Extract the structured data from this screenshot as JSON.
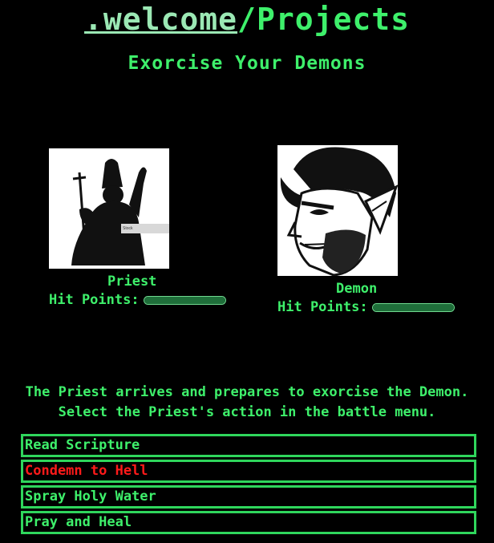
{
  "header": {
    "home_link": ".welcome",
    "separator": "/",
    "page": "Projects"
  },
  "game": {
    "title": "Exorcise Your Demons",
    "priest": {
      "name": "Priest",
      "hp_label": "Hit Points:",
      "hp_fraction": 1.0
    },
    "demon": {
      "name": "Demon",
      "hp_label": "Hit Points:",
      "hp_fraction": 1.0
    },
    "narration": {
      "line1": "The Priest arrives and prepares to exorcise the Demon.",
      "line2": "Select the Priest's action in the battle menu."
    },
    "menu": [
      {
        "label": "Read Scripture",
        "color": "#3ef06b"
      },
      {
        "label": "Condemn to Hell",
        "color": "#ff1a1a"
      },
      {
        "label": "Spray Holy Water",
        "color": "#3ef06b"
      },
      {
        "label": "Pray and Heal",
        "color": "#3ef06b"
      }
    ],
    "portrait_caption": "Stock"
  }
}
